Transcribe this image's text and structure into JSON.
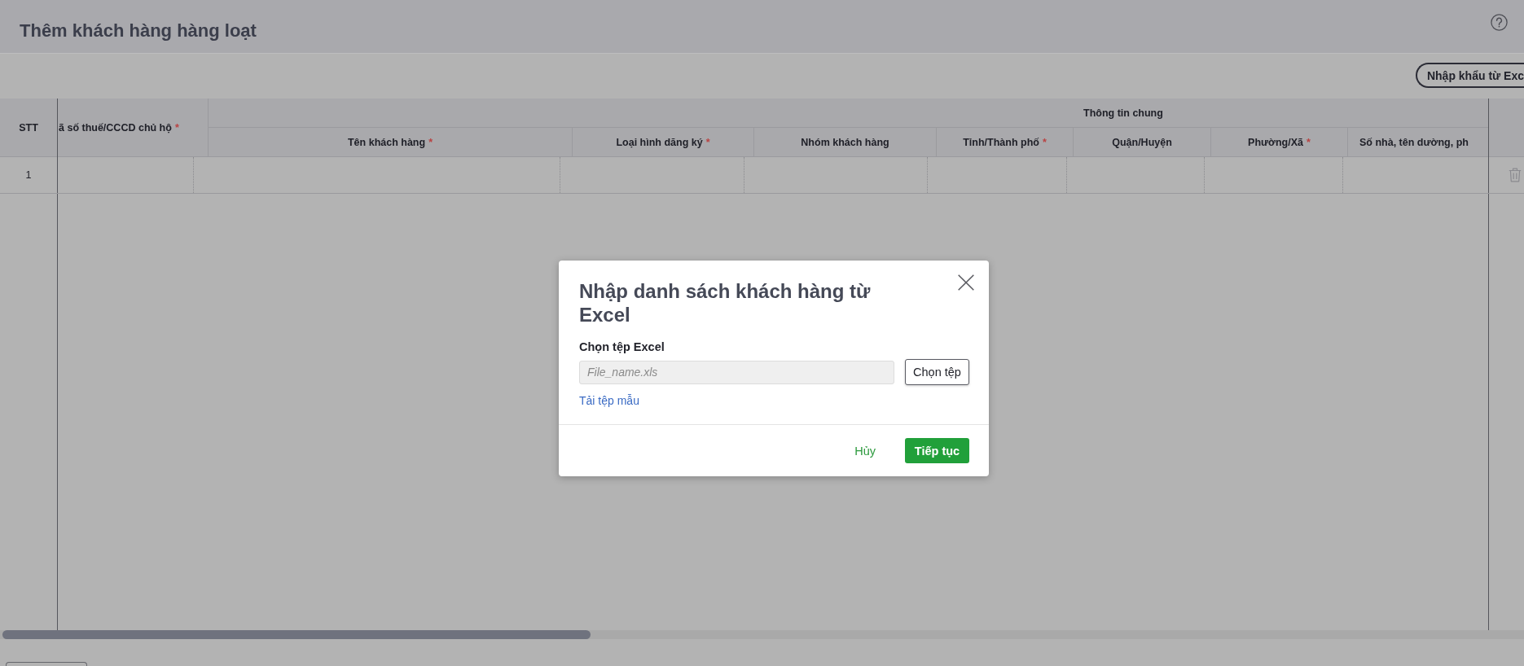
{
  "page_header": {
    "title": "Thêm khách hàng hàng loạt"
  },
  "toolbar": {
    "import_button": "Nhập khẩu từ Exc"
  },
  "table": {
    "row_number_header": "STT",
    "lead_column": {
      "label": "ã số thuế/CCCD chủ hộ",
      "required_mark": "*"
    },
    "group_header": "Thông tin chung",
    "columns": [
      {
        "label": "Tên khách hàng",
        "required_mark": "*"
      },
      {
        "label": "Loại hình dăng ký",
        "required_mark": "*"
      },
      {
        "label": "Nhóm khách hàng"
      },
      {
        "label": "Tỉnh/Thành phố",
        "required_mark": "*"
      },
      {
        "label": "Quận/Huyện"
      },
      {
        "label": "Phường/Xã",
        "required_mark": "*"
      },
      {
        "label": "Số nhà, tên dường, ph"
      }
    ],
    "rows": [
      {
        "number": "1"
      }
    ]
  },
  "dialog": {
    "title": "Nhập danh sách khách hàng từ Excel",
    "file_label": "Chọn tệp Excel",
    "file_field": {
      "placeholder": "File_name.xls"
    },
    "choose_button": "Chọn tệp",
    "template_link": "Tải tệp mẫu",
    "cancel_button": "Hủy",
    "continue_button": "Tiếp tục"
  }
}
